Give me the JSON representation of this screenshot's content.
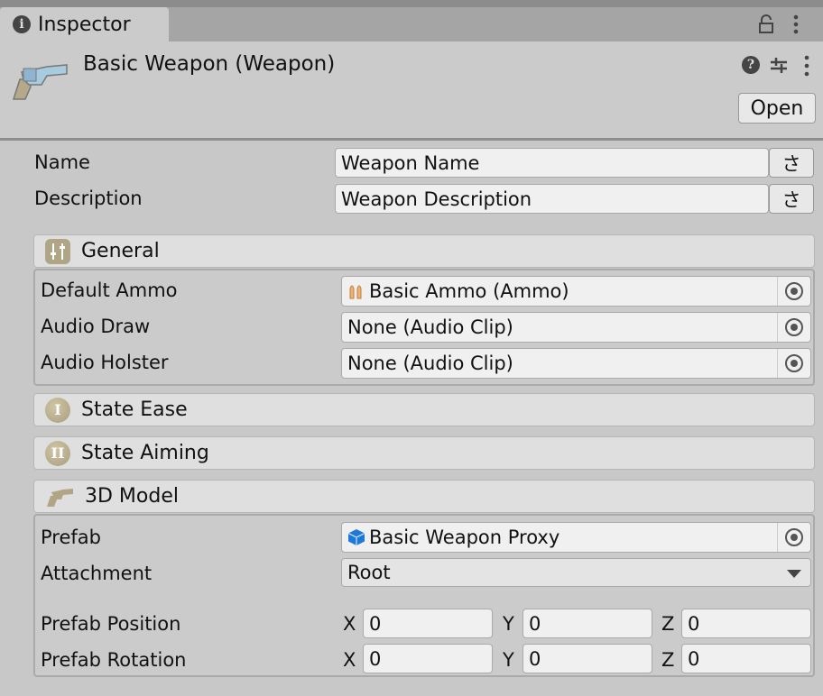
{
  "tab": {
    "title": "Inspector"
  },
  "header": {
    "title": "Basic Weapon (Weapon)",
    "open_label": "Open"
  },
  "fields": {
    "name": {
      "label": "Name",
      "value": "Weapon Name",
      "button": "さ"
    },
    "description": {
      "label": "Description",
      "value": "Weapon Description",
      "button": "さ"
    }
  },
  "sections": {
    "general": {
      "title": "General",
      "rows": [
        {
          "label": "Default Ammo",
          "value": "Basic Ammo (Ammo)"
        },
        {
          "label": "Audio Draw",
          "value": "None (Audio Clip)"
        },
        {
          "label": "Audio Holster",
          "value": "None (Audio Clip)"
        }
      ]
    },
    "state_ease": {
      "title": "State Ease",
      "icon_text": "I"
    },
    "state_aiming": {
      "title": "State Aiming",
      "icon_text": "II"
    },
    "model": {
      "title": "3D Model",
      "prefab": {
        "label": "Prefab",
        "value": "Basic Weapon Proxy"
      },
      "attachment": {
        "label": "Attachment",
        "value": "Root"
      },
      "position": {
        "label": "Prefab Position",
        "x": "0",
        "y": "0",
        "z": "0"
      },
      "rotation": {
        "label": "Prefab Rotation",
        "x": "0",
        "y": "0",
        "z": "0"
      },
      "axes": {
        "x": "X",
        "y": "Y",
        "z": "Z"
      }
    }
  }
}
